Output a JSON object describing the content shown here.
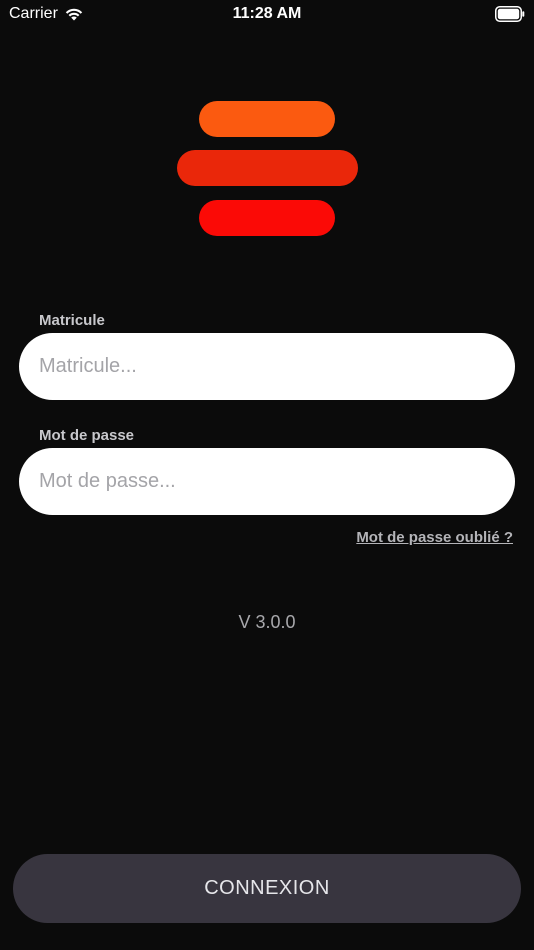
{
  "status_bar": {
    "carrier": "Carrier",
    "time": "11:28 AM",
    "wifi_icon": "wifi-icon",
    "battery_icon": "battery-full-icon"
  },
  "logo": {
    "colors": [
      "#fb5a10",
      "#ea270a",
      "#fb0a06"
    ]
  },
  "form": {
    "matricule_label": "Matricule",
    "matricule_placeholder": "Matricule...",
    "matricule_value": "",
    "password_label": "Mot de passe",
    "password_placeholder": "Mot de passe...",
    "password_value": "",
    "forgot_password": "Mot de passe oublié ?"
  },
  "version": "V 3.0.0",
  "connect_button": "CONNEXION",
  "colors": {
    "background": "#0b0b0b",
    "button": "#38353f"
  }
}
